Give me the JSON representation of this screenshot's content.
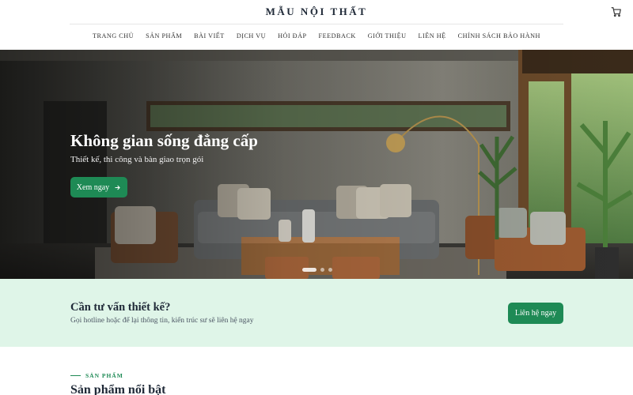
{
  "header": {
    "brand": "MẪU NỘI THẤT",
    "cart_icon": "cart-icon"
  },
  "nav": {
    "items": [
      "TRANG CHỦ",
      "SẢN PHẨM",
      "BÀI VIẾT",
      "DỊCH VỤ",
      "HỎI ĐÁP",
      "FEEDBACK",
      "GIỚI THIỆU",
      "LIÊN HỆ",
      "CHÍNH SÁCH BẢO HÀNH"
    ]
  },
  "hero": {
    "title": "Không gian sống đẳng cấp",
    "subtitle": "Thiết kế, thi công và bàn giao trọn gói",
    "button_label": "Xem ngay",
    "button_icon": "arrow-right-icon",
    "slides_count": 3,
    "active_slide": 1
  },
  "cta": {
    "title": "Cần tư vấn thiết kế?",
    "text": "Gọi hotline hoặc để lại thông tin, kiến trúc sư sẽ liên hệ ngay",
    "button_label": "Liên hệ ngay"
  },
  "products": {
    "eyebrow": "SẢN PHẨM",
    "title": "Sản phẩm nổi bật"
  },
  "colors": {
    "accent": "#1e8a55",
    "cta_bg": "#dff5e8"
  }
}
